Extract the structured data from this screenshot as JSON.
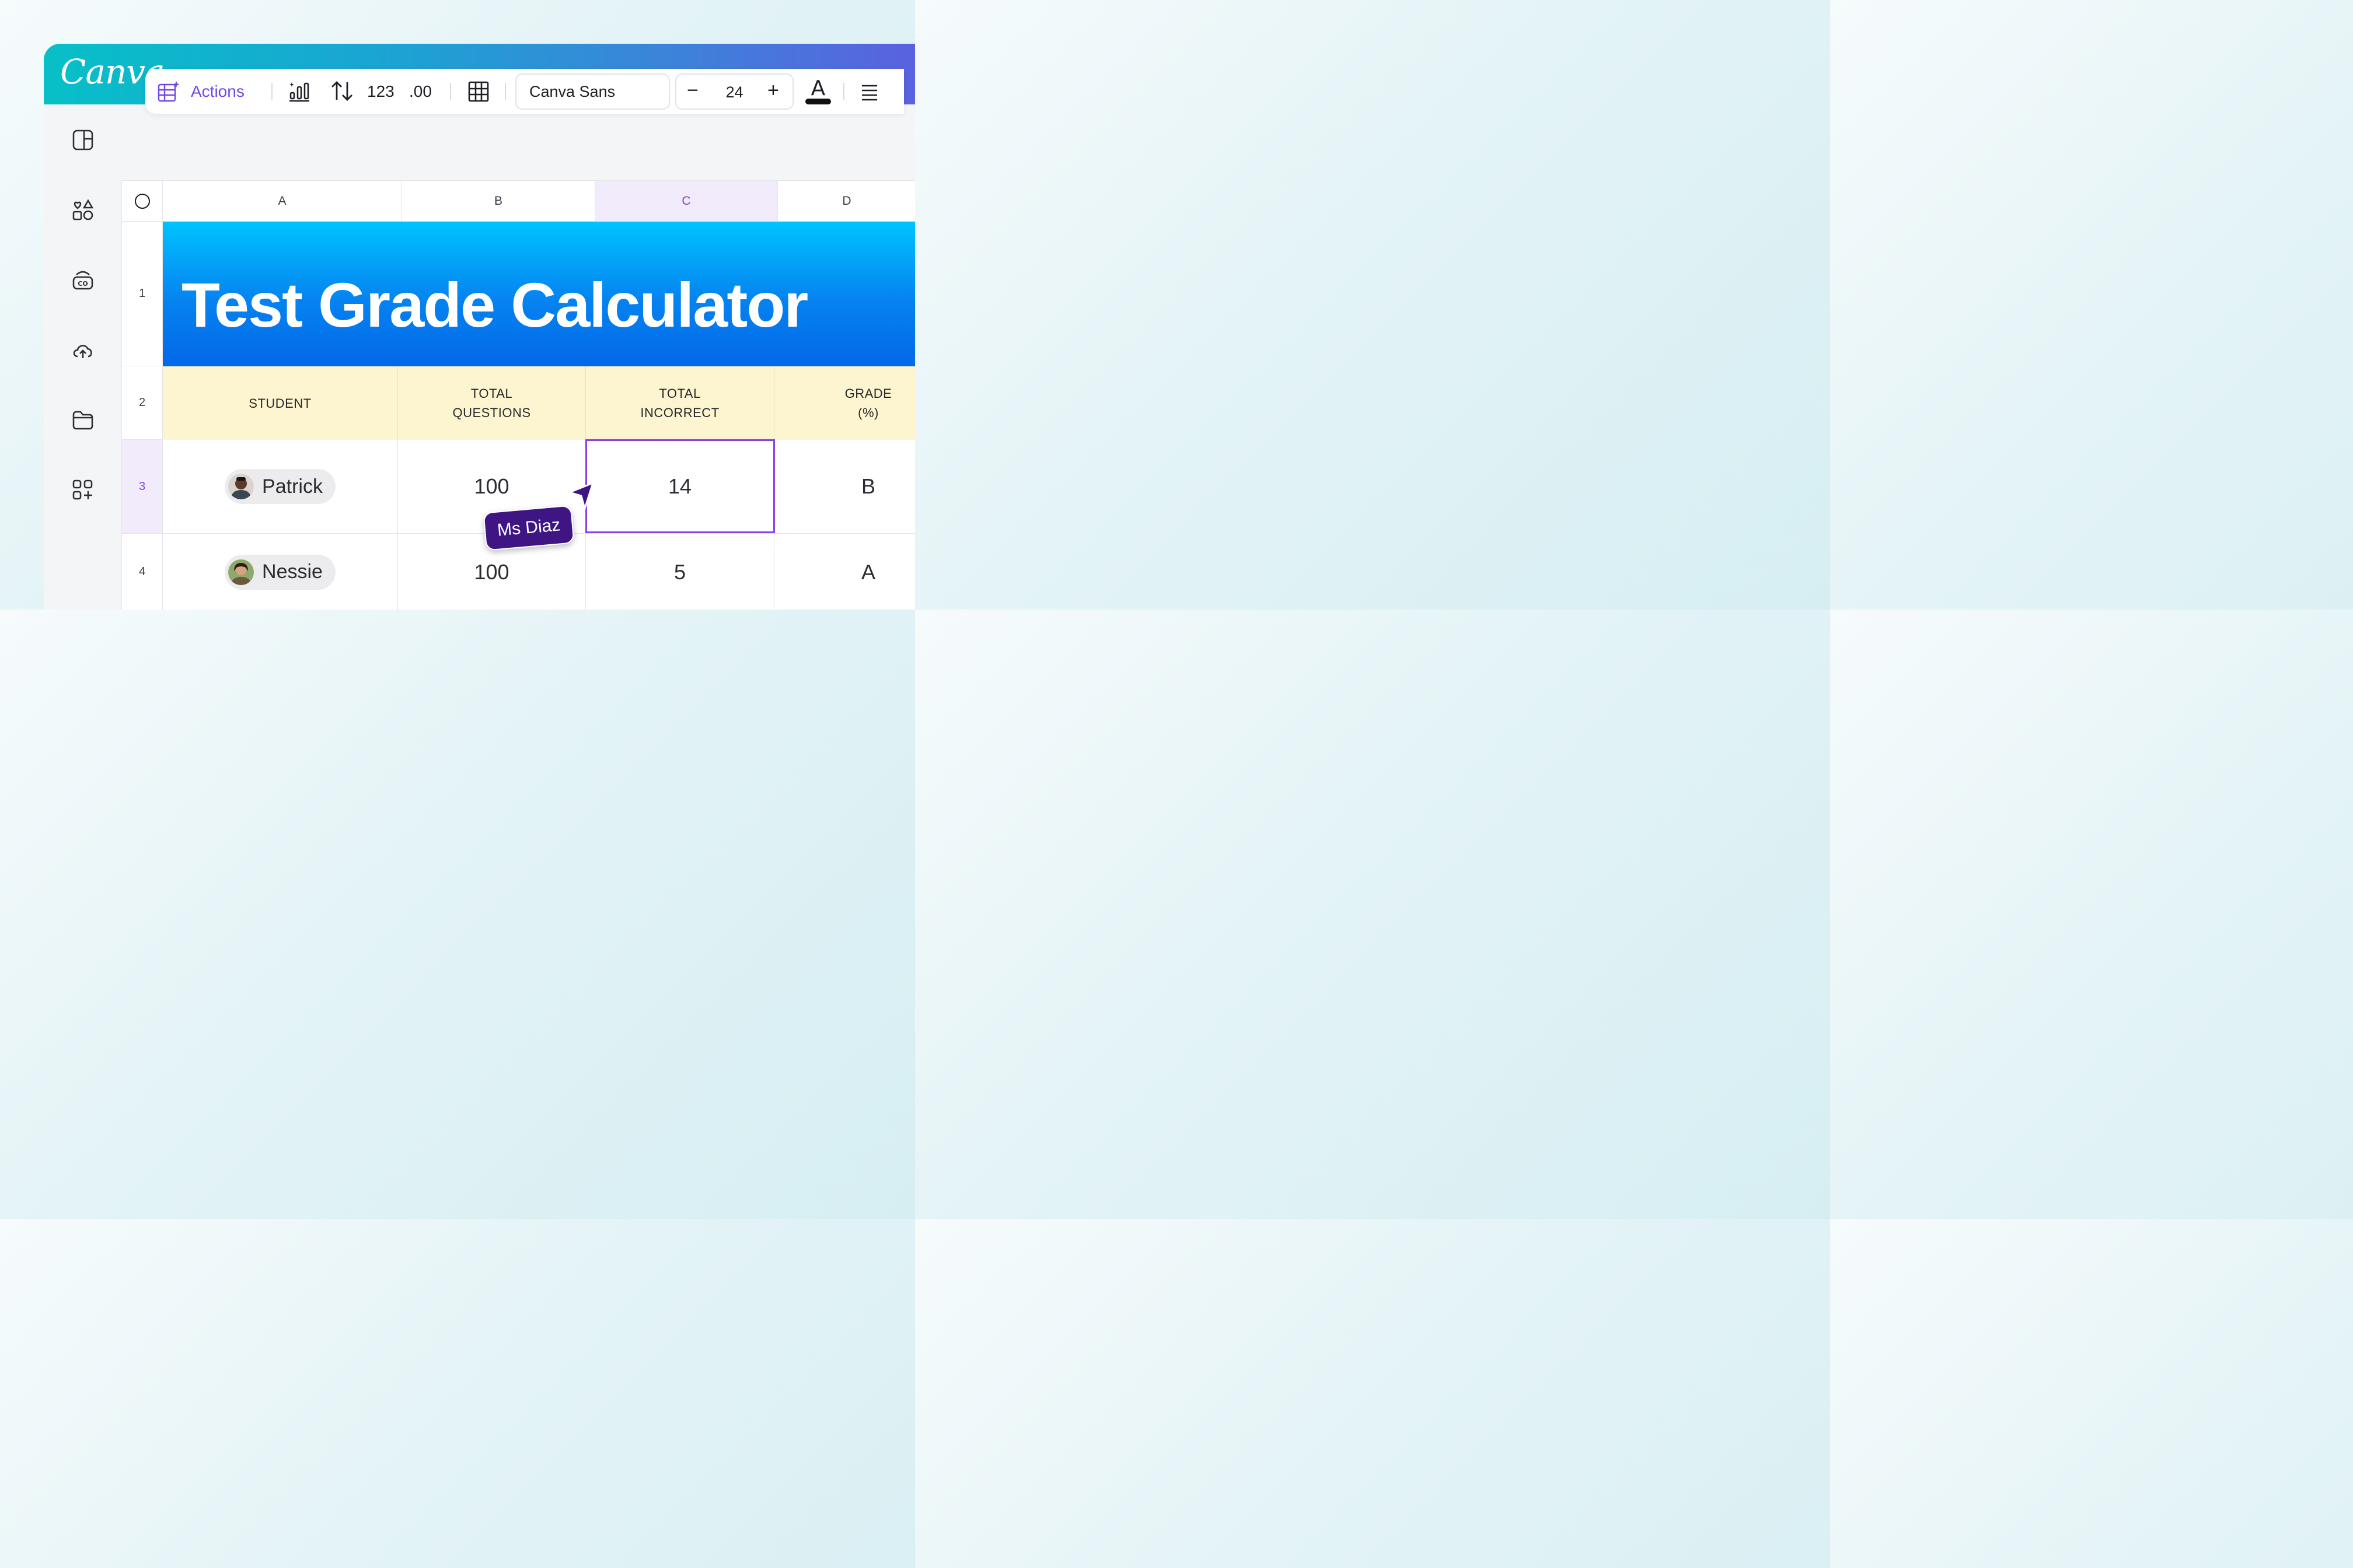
{
  "app": {
    "logo": "Canva"
  },
  "sidebar": {
    "icons": [
      "layout-icon",
      "elements-icon",
      "brand-icon",
      "uploads-icon",
      "projects-icon",
      "apps-icon"
    ]
  },
  "toolbar": {
    "actions_label": "Actions",
    "number_format": "123",
    "decimal_format": ".00",
    "font_name": "Canva Sans",
    "font_size": "24"
  },
  "sheet": {
    "columns": [
      "A",
      "B",
      "C",
      "D"
    ],
    "selected_column": "C",
    "rows": [
      "1",
      "2",
      "3",
      "4"
    ],
    "selected_row": "3",
    "title": "Test Grade Calculator",
    "headers": [
      "STUDENT",
      "TOTAL\nQUESTIONS",
      "TOTAL\nINCORRECT",
      "GRADE\n(%)"
    ],
    "data": [
      {
        "student": "Patrick",
        "total_questions": "100",
        "total_incorrect": "14",
        "grade": "B"
      },
      {
        "student": "Nessie",
        "total_questions": "100",
        "total_incorrect": "5",
        "grade": "A"
      }
    ]
  },
  "collaborator": {
    "name": "Ms Diaz",
    "color": "#3e1583"
  },
  "colors": {
    "accent": "#7146e6",
    "selection": "#8b3fe6",
    "header_fill": "#fdf5cf",
    "title_band": "#0582f0"
  }
}
